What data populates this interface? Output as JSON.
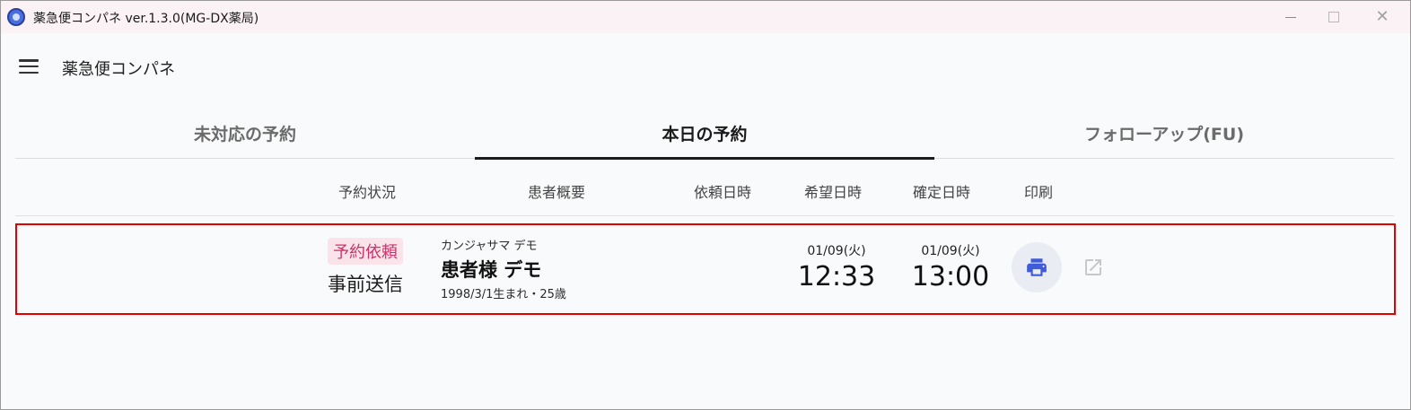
{
  "window": {
    "title": "薬急便コンパネ ver.1.3.0(MG-DX薬局)",
    "icon": "app-logo-icon"
  },
  "appbar": {
    "title": "薬急便コンパネ",
    "menu_icon": "hamburger-menu-icon"
  },
  "tabs": [
    {
      "label": "未対応の予約",
      "active": false
    },
    {
      "label": "本日の予約",
      "active": true
    },
    {
      "label": "フォローアップ(FU)",
      "active": false
    }
  ],
  "table": {
    "headers": [
      "予約状況",
      "患者概要",
      "依頼日時",
      "希望日時",
      "確定日時",
      "印刷"
    ],
    "rows": [
      {
        "status_badge": "予約依頼",
        "status_sub": "事前送信",
        "patient_kana": "カンジャサマ デモ",
        "patient_name": "患者様 デモ",
        "patient_birth": "1998/3/1生まれ・25歳",
        "requested": {
          "date": "01/09(火)",
          "time": "12:33"
        },
        "confirmed": {
          "date": "01/09(火)",
          "time": "13:00"
        },
        "print_icon": "printer-icon",
        "open_icon": "external-link-icon"
      }
    ]
  },
  "colors": {
    "badge_bg": "#fbe3ea",
    "badge_text": "#d0306a",
    "print_icon": "#3f5bd8",
    "highlight_border": "#e20000"
  }
}
